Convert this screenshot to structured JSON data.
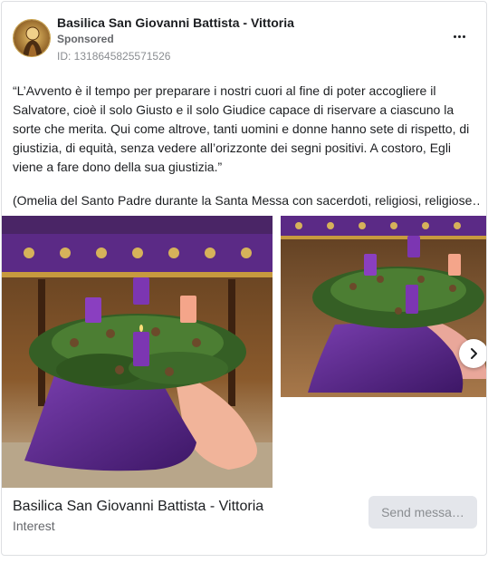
{
  "header": {
    "page_name": "Basilica San Giovanni Battista - Vittoria",
    "sponsored_label": "Sponsored",
    "ad_id": "ID: 1318645825571526"
  },
  "post": {
    "paragraph_1": "“L’Avvento è il tempo per preparare i nostri cuori al fine di poter accogliere il Salvatore, cioè il solo Giusto e il solo Giudice capace di riservare a ciascuno la sorte che merita. Qui come altrove, tanti uomini e donne hanno sete di rispetto, di giustizia, di equità, senza vedere all’orizzonte dei segni positivi. A costoro, Egli viene a fare dono della sua giustizia.”",
    "paragraph_2": "(Omelia del Santo Padre durante la Santa Messa con sacerdoti, religiosi, religiose…"
  },
  "carousel": {
    "slides": [
      "advent-wreath-photo",
      "advent-wreath-photo"
    ],
    "next_icon": "chevron-right-icon"
  },
  "footer": {
    "title": "Basilica San Giovanni Battista - Vittoria",
    "subtitle": "Interest",
    "cta_label": "Send messa…"
  },
  "colors": {
    "purple": "#5b2a86",
    "candle_pink": "#f4a58a",
    "greenery": "#3f6a2c",
    "button_bg": "#e4e6eb"
  }
}
